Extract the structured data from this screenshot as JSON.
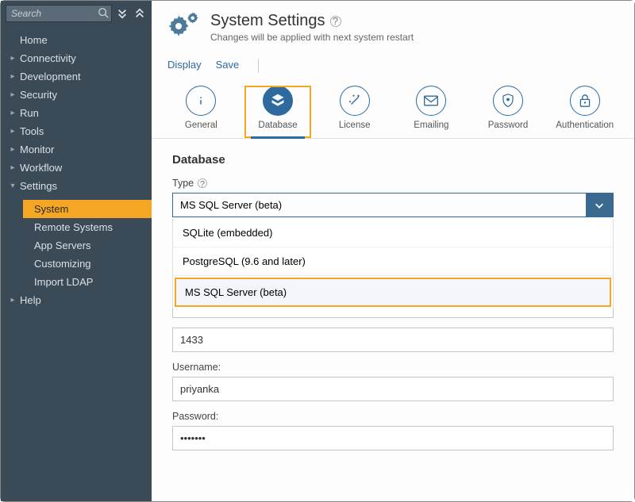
{
  "sidebar": {
    "search_placeholder": "Search",
    "items": [
      {
        "label": "Home",
        "expandable": false
      },
      {
        "label": "Connectivity",
        "expandable": true
      },
      {
        "label": "Development",
        "expandable": true
      },
      {
        "label": "Security",
        "expandable": true
      },
      {
        "label": "Run",
        "expandable": true
      },
      {
        "label": "Tools",
        "expandable": true
      },
      {
        "label": "Monitor",
        "expandable": true
      },
      {
        "label": "Workflow",
        "expandable": true
      },
      {
        "label": "Settings",
        "expandable": true,
        "expanded": true,
        "children": [
          {
            "label": "System",
            "selected": true
          },
          {
            "label": "Remote Systems"
          },
          {
            "label": "App Servers"
          },
          {
            "label": "Customizing"
          },
          {
            "label": "Import LDAP"
          }
        ]
      },
      {
        "label": "Help",
        "expandable": true
      }
    ]
  },
  "header": {
    "title": "System Settings",
    "subtitle": "Changes will be applied with next system restart"
  },
  "actions": {
    "display": "Display",
    "save": "Save"
  },
  "tabs": [
    {
      "label": "General",
      "icon": "info"
    },
    {
      "label": "Database",
      "icon": "database",
      "active": true
    },
    {
      "label": "License",
      "icon": "wand"
    },
    {
      "label": "Emailing",
      "icon": "mail"
    },
    {
      "label": "Password",
      "icon": "shield"
    },
    {
      "label": "Authentication",
      "icon": "lock"
    }
  ],
  "form": {
    "section_title": "Database",
    "type_label": "Type",
    "type_value": "MS SQL Server (beta)",
    "type_options": [
      "SQLite (embedded)",
      "PostgreSQL (9.6 and later)",
      "MS SQL Server (beta)"
    ],
    "port_value": "1433",
    "username_label": "Username:",
    "username_value": "priyanka",
    "password_label": "Password:",
    "password_value": "•••••••"
  }
}
